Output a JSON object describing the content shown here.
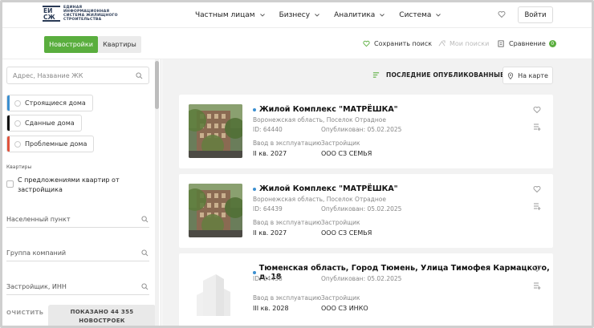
{
  "header": {
    "logo_text": "ЕДИНАЯ ИНФОРМАЦИОННАЯ СИСТЕМА ЖИЛИЩНОГО СТРОИТЕЛЬСТВА",
    "nav": [
      {
        "label": "Частным лицам"
      },
      {
        "label": "Бизнесу"
      },
      {
        "label": "Аналитика"
      },
      {
        "label": "Система"
      }
    ],
    "login_label": "Войти"
  },
  "subbar": {
    "tab_new": "Новостройки",
    "tab_flats": "Квартиры",
    "save_search": "Сохранить поиск",
    "my_searches": "Мои поиски",
    "compare": "Сравнение",
    "compare_count": "0"
  },
  "sidebar": {
    "search_placeholder": "Адрес, Название ЖК",
    "chips": [
      {
        "label": "Строящиеся дома",
        "color": "#3c8fd0"
      },
      {
        "label": "Сданные дома",
        "color": "#111111"
      },
      {
        "label": "Проблемные дома",
        "color": "#e0533d"
      }
    ],
    "section_label": "Квартиры",
    "checkbox_label": "С предложениями квартир от застройщика",
    "fields": [
      {
        "label": "Населенный пункт"
      },
      {
        "label": "Группа компаний"
      },
      {
        "label": "Застройщик, ИНН"
      }
    ],
    "clear_label": "ОЧИСТИТЬ",
    "show_label_line1": "ПОКАЗАНО 44 355",
    "show_label_line2": "НОВОСТРОЕК"
  },
  "main": {
    "sort_label": "ПОСЛЕДНИЕ ОПУБЛИКОВАННЫЕ",
    "map_label": "На карте",
    "commission_label": "Ввод в эксплуатацию",
    "developer_label": "Застройщик",
    "cards": [
      {
        "title": "Жилой Комплекс \"МАТРЁШКА\"",
        "address": "Воронежская область, Поселок Отрадное",
        "id": "ID: 64440",
        "published": "Опубликован: 05.02.2025",
        "commission": "II кв. 2027",
        "developer": "ООО СЗ СЕМЬЯ",
        "image": "photo"
      },
      {
        "title": "Жилой Комплекс \"МАТРЁШКА\"",
        "address": "Воронежская область, Поселок Отрадное",
        "id": "ID: 64439",
        "published": "Опубликован: 05.02.2025",
        "commission": "II кв. 2027",
        "developer": "ООО СЗ СЕМЬЯ",
        "image": "photo"
      },
      {
        "title": "Тюменская область, Город Тюмень, Улица Тимофея Кармацкого, д. 18",
        "address": "",
        "id": "ID: 64438",
        "published": "Опубликован: 05.02.2025",
        "commission": "III кв. 2028",
        "developer": "ООО СЗ ИНКО",
        "image": "placeholder"
      }
    ]
  }
}
